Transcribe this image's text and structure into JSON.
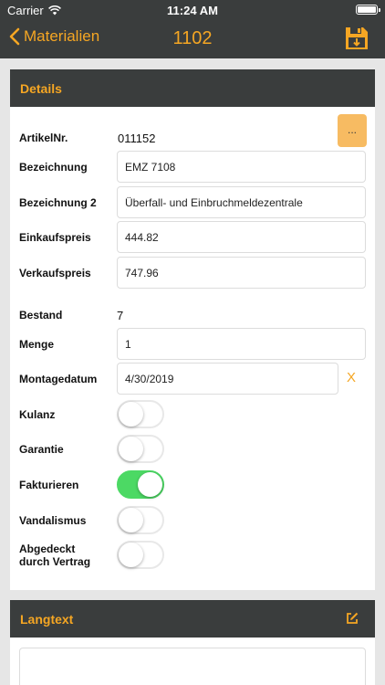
{
  "status": {
    "carrier": "Carrier",
    "time": "11:24 AM"
  },
  "nav": {
    "back_label": "Materialien",
    "title": "1102",
    "save_icon": "save-download-icon"
  },
  "details": {
    "header": "Details",
    "artikelnr": {
      "label": "ArtikelNr.",
      "value": "011152",
      "button": "..."
    },
    "bezeichnung": {
      "label": "Bezeichnung",
      "value": "EMZ 7108"
    },
    "bezeichnung2": {
      "label": "Bezeichnung 2",
      "value": "Überfall- und Einbruchmeldezentrale"
    },
    "einkaufspreis": {
      "label": "Einkaufspreis",
      "value": "444.82"
    },
    "verkaufspreis": {
      "label": "Verkaufspreis",
      "value": "747.96"
    },
    "bestand": {
      "label": "Bestand",
      "value": "7"
    },
    "menge": {
      "label": "Menge",
      "value": "1"
    },
    "montagedatum": {
      "label": "Montagedatum",
      "value": "4/30/2019",
      "clear": "X"
    },
    "kulanz": {
      "label": "Kulanz",
      "on": false
    },
    "garantie": {
      "label": "Garantie",
      "on": false
    },
    "fakturieren": {
      "label": "Fakturieren",
      "on": true
    },
    "vandalismus": {
      "label": "Vandalismus",
      "on": false
    },
    "abgedeckt": {
      "label_line1": "Abgedeckt",
      "label_line2": "durch Vertrag",
      "on": false
    }
  },
  "langtext": {
    "header": "Langtext",
    "value": ""
  },
  "colors": {
    "accent": "#f5a623",
    "header_bg": "#3a3d3d",
    "toggle_on": "#4cd964",
    "button_bg": "#f7bb62"
  }
}
